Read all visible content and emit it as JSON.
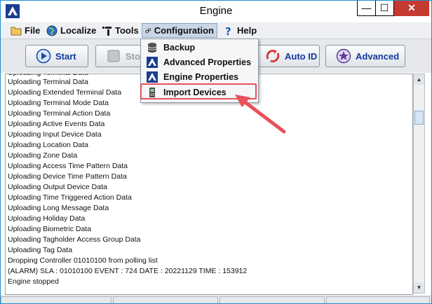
{
  "window": {
    "title": "Engine",
    "controls": {
      "minimize": "—",
      "maximize": "☐",
      "close": "✕"
    }
  },
  "menubar": {
    "items": [
      {
        "label": "File",
        "icon": "folder-icon"
      },
      {
        "label": "Localize",
        "icon": "globe-icon"
      },
      {
        "label": "Tools",
        "icon": "tools-icon"
      },
      {
        "label": "Configuration",
        "icon": "gears-icon",
        "active": true
      },
      {
        "label": "Help",
        "icon": "help-icon"
      }
    ]
  },
  "toolbar": {
    "start": "Start",
    "stop": "Stop",
    "auto_id": "Auto ID",
    "advanced": "Advanced"
  },
  "dropdown": {
    "items": [
      {
        "label": "Backup",
        "icon": "database-icon"
      },
      {
        "label": "Advanced Properties",
        "icon": "app-logo-icon"
      },
      {
        "label": "Engine Properties",
        "icon": "app-logo-icon"
      },
      {
        "label": "Import Devices",
        "icon": "device-icon",
        "highlighted": true
      }
    ]
  },
  "log": {
    "lines": [
      "Uploading Terminal Data",
      "Uploading Extended Terminal Data",
      "Uploading Terminal Mode Data",
      "Uploading Terminal Action Data",
      "Uploading Active Events Data",
      "Uploading Input Device Data",
      "Uploading Location Data",
      "Uploading Zone Data",
      "Uploading Access Time Pattern Data",
      "Uploading Device Time Pattern Data",
      "Uploading Output Device Data",
      "Uploading Time Triggered Action Data",
      "Uploading Long Message Data",
      "Uploading Holiday Data",
      "Uploading Biometric Data",
      "Uploading Tagholder Access Group Data",
      "Uploading Tag Data",
      "Dropping Controller 01010100 from polling list",
      "(ALARM) SLA : 01010100 EVENT : 724 DATE : 20221129 TIME : 153912",
      "Engine stopped"
    ]
  },
  "colors": {
    "highlight": "#e8505b",
    "accent": "#123a9c",
    "close": "#c53a31"
  }
}
